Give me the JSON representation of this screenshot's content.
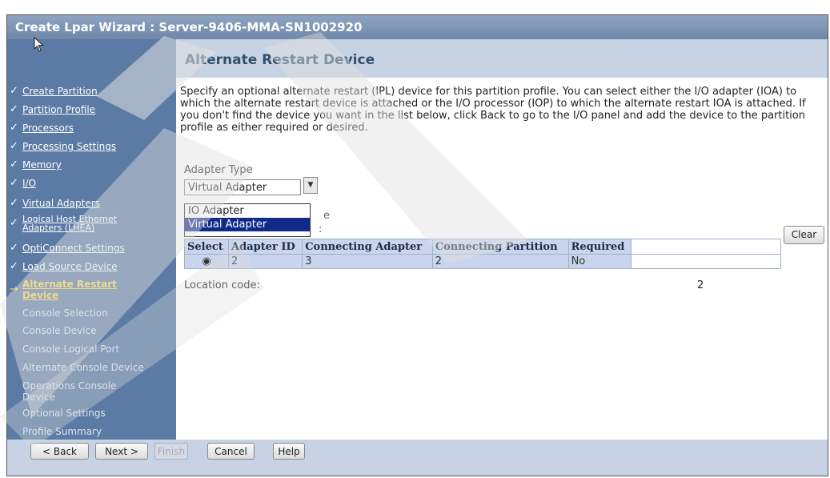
{
  "window": {
    "title": "Create Lpar Wizard : Server-9406-MMA-SN1002920"
  },
  "nav": {
    "steps": [
      {
        "label": "Create Partition",
        "state": "done"
      },
      {
        "label": "Partition Profile",
        "state": "done"
      },
      {
        "label": "Processors",
        "state": "done"
      },
      {
        "label": "Processing Settings",
        "state": "done"
      },
      {
        "label": "Memory",
        "state": "done"
      },
      {
        "label": "I/O",
        "state": "done"
      },
      {
        "label": "Virtual Adapters",
        "state": "done"
      },
      {
        "label": "Logical Host Ethernet Adapters (LHEA)",
        "state": "done"
      },
      {
        "label": "OptiConnect Settings",
        "state": "done"
      },
      {
        "label": "Load Source Device",
        "state": "done"
      },
      {
        "label": "Alternate Restart Device",
        "state": "current"
      },
      {
        "label": "Console Selection",
        "state": "todo"
      },
      {
        "label": "Console Device",
        "state": "todo"
      },
      {
        "label": "Console Logical Port",
        "state": "todo"
      },
      {
        "label": "Alternate Console Device",
        "state": "todo"
      },
      {
        "label": "Operations Console Device",
        "state": "todo"
      },
      {
        "label": "Optional Settings",
        "state": "todo"
      },
      {
        "label": "Profile Summary",
        "state": "todo"
      }
    ],
    "done_mark": "✓",
    "current_mark": "→"
  },
  "main": {
    "heading": "Alternate Restart Device",
    "description": "Specify an optional alternate restart (IPL) device for this partition profile. You can select either the I/O adapter (IOA) to which the alternate restart device is attached or the I/O processor (IOP) to which the alternate restart IOA is attached. If you don't find the device you want in the list below, click Back to go to the I/O panel and add the device to the partition profile as either required or desired.",
    "adapter_type_label": "Adapter Type",
    "adapter_type_value": "Virtual Adapter",
    "dropdown_options": [
      "IO Adapter",
      "Virtual Adapter"
    ],
    "dropdown_selected": "Virtual Adapter",
    "obscured_text_1": "e",
    "obscured_text_2": ":",
    "clear_label": "Clear",
    "table": {
      "headers": [
        "Select",
        "Adapter ID",
        "Connecting Adapter",
        "Connecting Partition",
        "Required",
        ""
      ],
      "rows": [
        {
          "adapter_id": "2",
          "connecting_adapter": "3",
          "connecting_partition": "2",
          "required": "No"
        }
      ]
    },
    "location_label": "Location code:",
    "location_value": "2"
  },
  "footer": {
    "back": "< Back",
    "next": "Next >",
    "finish": "Finish",
    "cancel": "Cancel",
    "help": "Help"
  }
}
